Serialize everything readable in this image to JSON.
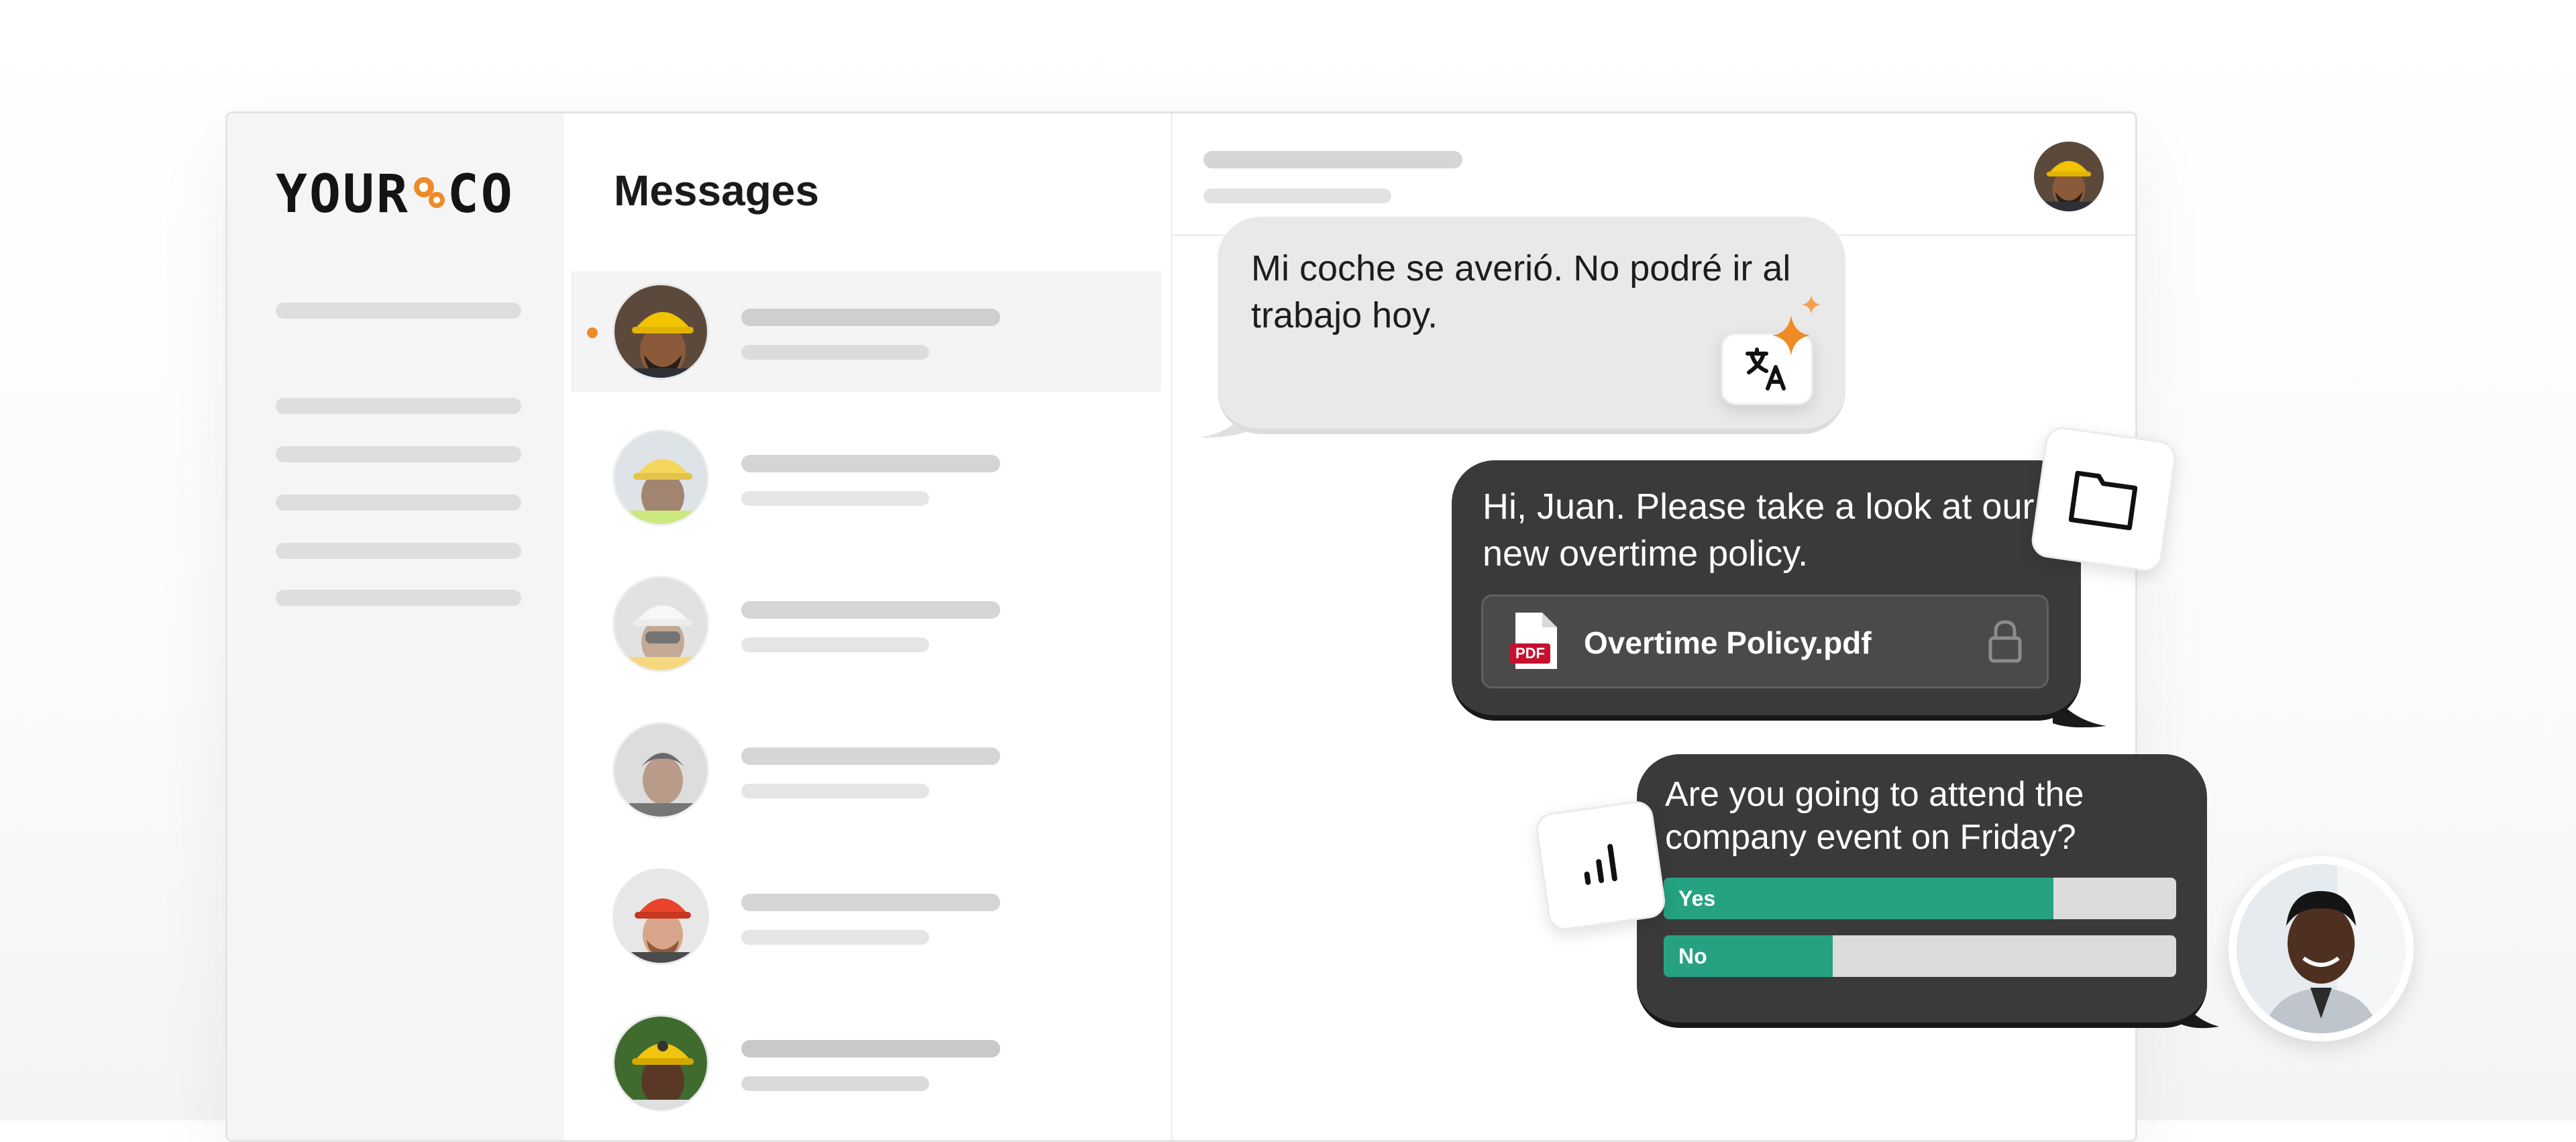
{
  "brand": {
    "logo_left": "YOUR",
    "logo_right": "CO",
    "accent": "#ee8a2a"
  },
  "messages_panel": {
    "title": "Messages",
    "conversations": [
      {
        "avatar": "worker-yellow-helmet",
        "unread": true,
        "active": true
      },
      {
        "avatar": "worker-yellow-helmet-vest"
      },
      {
        "avatar": "worker-white-helmet"
      },
      {
        "avatar": "man-short-hair"
      },
      {
        "avatar": "worker-orange-helmet"
      },
      {
        "avatar": "worker-yellow-helmet-2"
      }
    ]
  },
  "chat": {
    "incoming_message": {
      "text": "Mi coche se averió. No podré ir al trabajo hoy.",
      "action": "translate-icon"
    },
    "outgoing_message": {
      "text": "Hi, Juan. Please take a look at our new overtime policy.",
      "attachment": {
        "name": "Overtime Policy.pdf",
        "badge": "PDF",
        "locked": true
      }
    },
    "poll_message": {
      "question": "Are you going to attend the company event on Friday?",
      "options": [
        {
          "label": "Yes",
          "fraction": 0.76
        },
        {
          "label": "No",
          "fraction": 0.33
        }
      ],
      "poll_color": "#26a283"
    }
  },
  "floating_icons": [
    "folder-icon",
    "poll-chart-icon",
    "translate-icon"
  ]
}
